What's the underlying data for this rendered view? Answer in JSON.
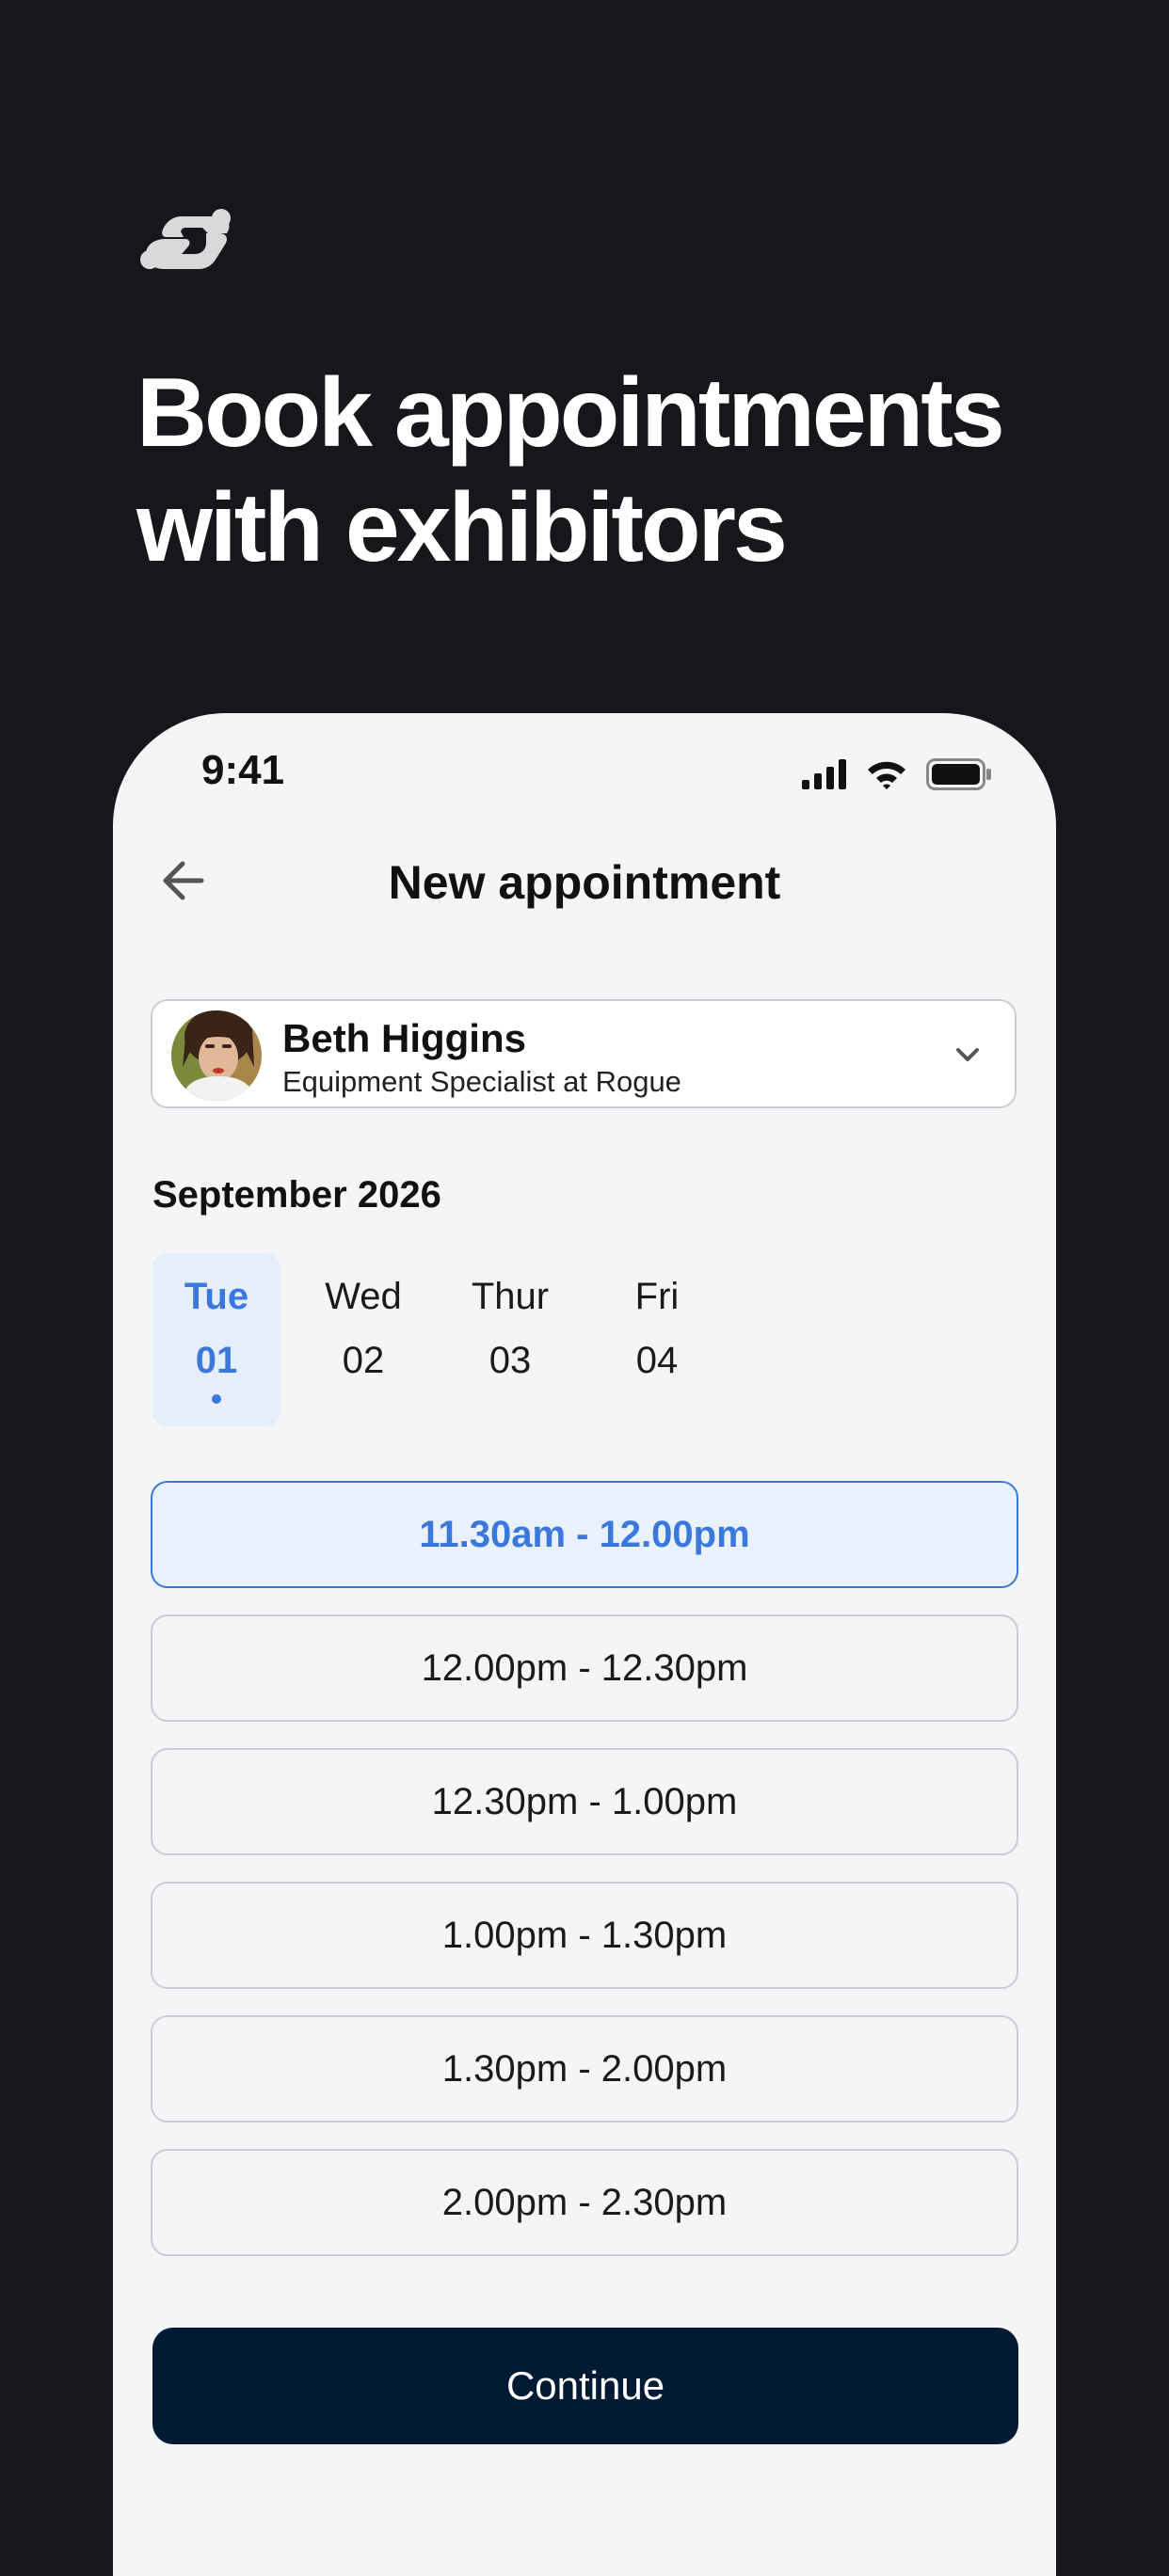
{
  "hero": {
    "logo_icon": "linked-hands-logo-icon",
    "headline_line1": "Book appointments",
    "headline_line2": "with exhibitors"
  },
  "status_bar": {
    "time": "9:41",
    "icons": [
      "cellular-signal-icon",
      "wifi-icon",
      "battery-icon"
    ]
  },
  "nav": {
    "back_icon": "arrow-left-icon",
    "title": "New appointment"
  },
  "exhibitor": {
    "name": "Beth Higgins",
    "role": "Equipment Specialist at Rogue",
    "dropdown_icon": "chevron-down-icon"
  },
  "calendar": {
    "month": "September 2026",
    "days": [
      {
        "name": "Tue",
        "num": "01",
        "selected": true
      },
      {
        "name": "Wed",
        "num": "02",
        "selected": false
      },
      {
        "name": "Thur",
        "num": "03",
        "selected": false
      },
      {
        "name": "Fri",
        "num": "04",
        "selected": false
      }
    ]
  },
  "slots": [
    {
      "label": "11.30am - 12.00pm",
      "selected": true
    },
    {
      "label": "12.00pm - 12.30pm",
      "selected": false
    },
    {
      "label": "12.30pm - 1.00pm",
      "selected": false
    },
    {
      "label": "1.00pm - 1.30pm",
      "selected": false
    },
    {
      "label": "1.30pm - 2.00pm",
      "selected": false
    },
    {
      "label": "2.00pm - 2.30pm",
      "selected": false
    }
  ],
  "actions": {
    "continue_label": "Continue"
  },
  "colors": {
    "background": "#16171a",
    "accent": "#3b78dd",
    "button": "#001a33",
    "card": "#f4f5f7"
  }
}
